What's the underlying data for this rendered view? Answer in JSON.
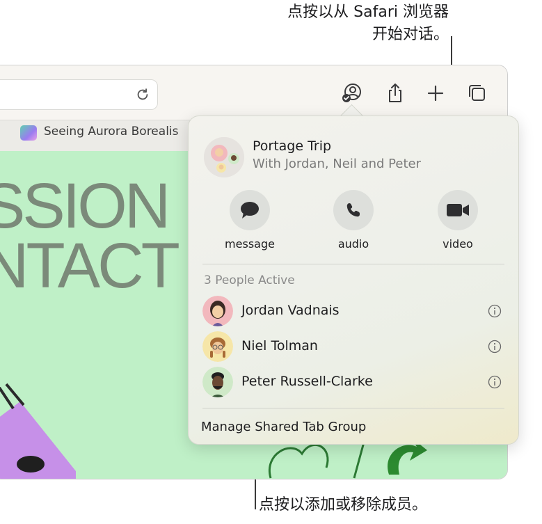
{
  "callouts": {
    "top_line1": "点按以从 Safari 浏览器",
    "top_line2": "开始对话。",
    "bottom": "点按以添加或移除成员。"
  },
  "browser": {
    "tab_title": "Seeing Aurora Borealis",
    "hero_line1": "SSION",
    "hero_line2": "NTACT"
  },
  "popover": {
    "group_title": "Portage Trip",
    "group_subtitle": "With Jordan, Neil and Peter",
    "actions": [
      {
        "label": "message",
        "icon": "message-bubble-icon"
      },
      {
        "label": "audio",
        "icon": "phone-icon"
      },
      {
        "label": "video",
        "icon": "video-camera-icon"
      }
    ],
    "people_heading": "3 People Active",
    "people": [
      {
        "name": "Jordan Vadnais",
        "avatar_color": "#f2b8bd"
      },
      {
        "name": "Niel Tolman",
        "avatar_color": "#f6e6a8"
      },
      {
        "name": "Peter Russell-Clarke",
        "avatar_color": "#cfe9c8"
      }
    ],
    "manage_label": "Manage Shared Tab Group"
  },
  "colors": {
    "content_background": "#bff0c7",
    "icon_gray": "#3a3a3c"
  }
}
